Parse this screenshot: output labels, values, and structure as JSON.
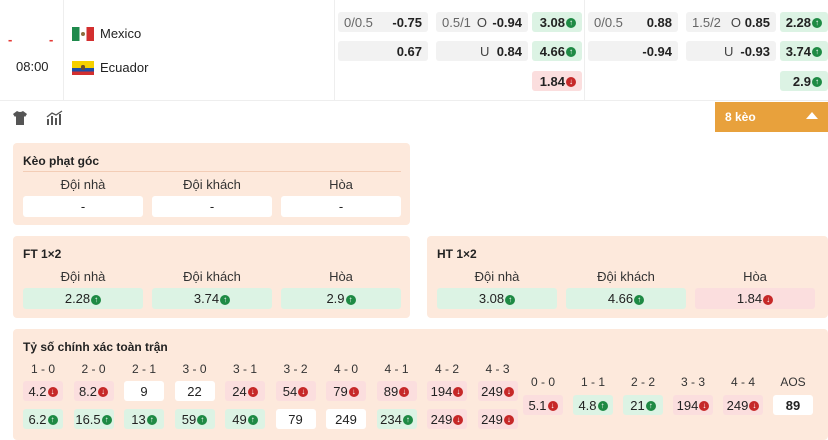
{
  "match": {
    "score_home": "-",
    "score_away": "-",
    "time": "08:00",
    "home_team": "Mexico",
    "away_team": "Ecuador",
    "ft_handicap": {
      "line": "0/0.5",
      "home": "-0.75",
      "away": "0.67"
    },
    "ft_ou": {
      "line": "0.5/1",
      "over_label": "O",
      "over": "-0.94",
      "under_label": "U",
      "under": "0.84"
    },
    "ft_1x2": {
      "home": "3.08",
      "away": "4.66",
      "draw": "1.84"
    },
    "ht_handicap": {
      "line": "0/0.5",
      "home": "0.88",
      "away": "-0.94"
    },
    "ht_ou": {
      "line": "1.5/2",
      "over_label": "O",
      "over": "0.85",
      "under_label": "U",
      "under": "-0.93"
    },
    "ht_1x2": {
      "home": "2.28",
      "away": "3.74",
      "draw": "2.9"
    }
  },
  "toolbar": {
    "shirt_icon": "shirt-icon",
    "stats_icon": "stats-icon",
    "more_label": "8 kèo"
  },
  "corner": {
    "title": "Kèo phạt góc",
    "headers": [
      "Đội nhà",
      "Đội khách",
      "Hòa"
    ],
    "values": [
      "-",
      "-",
      "-"
    ]
  },
  "ft1x2": {
    "title": "FT 1×2",
    "headers": [
      "Đội nhà",
      "Đội khách",
      "Hòa"
    ],
    "values": [
      "2.28",
      "3.74",
      "2.9"
    ]
  },
  "ht1x2": {
    "title": "HT 1×2",
    "headers": [
      "Đội nhà",
      "Đội khách",
      "Hòa"
    ],
    "values": [
      "3.08",
      "4.66",
      "1.84"
    ]
  },
  "correct_score": {
    "title": "Tỷ số chính xác toàn trận",
    "left_headers": [
      "1 - 0",
      "2 - 0",
      "2 - 1",
      "3 - 0",
      "3 - 1",
      "3 - 2",
      "4 - 0",
      "4 - 1",
      "4 - 2",
      "4 - 3"
    ],
    "row1": [
      "4.2",
      "8.2",
      "9",
      "22",
      "24",
      "54",
      "79",
      "89",
      "194",
      "249"
    ],
    "row2": [
      "6.2",
      "16.5",
      "13",
      "59",
      "49",
      "79",
      "249",
      "234",
      "249",
      "249"
    ],
    "right_headers": [
      "0 - 0",
      "1 - 1",
      "2 - 2",
      "3 - 3",
      "4 - 4",
      "AOS"
    ],
    "right_values": [
      "5.1",
      "4.8",
      "21",
      "194",
      "249",
      "89"
    ]
  },
  "colors": {
    "accent": "#e8a13c",
    "panel": "#fde9dc",
    "up": "#dcf3e4",
    "down": "#fbdede"
  }
}
